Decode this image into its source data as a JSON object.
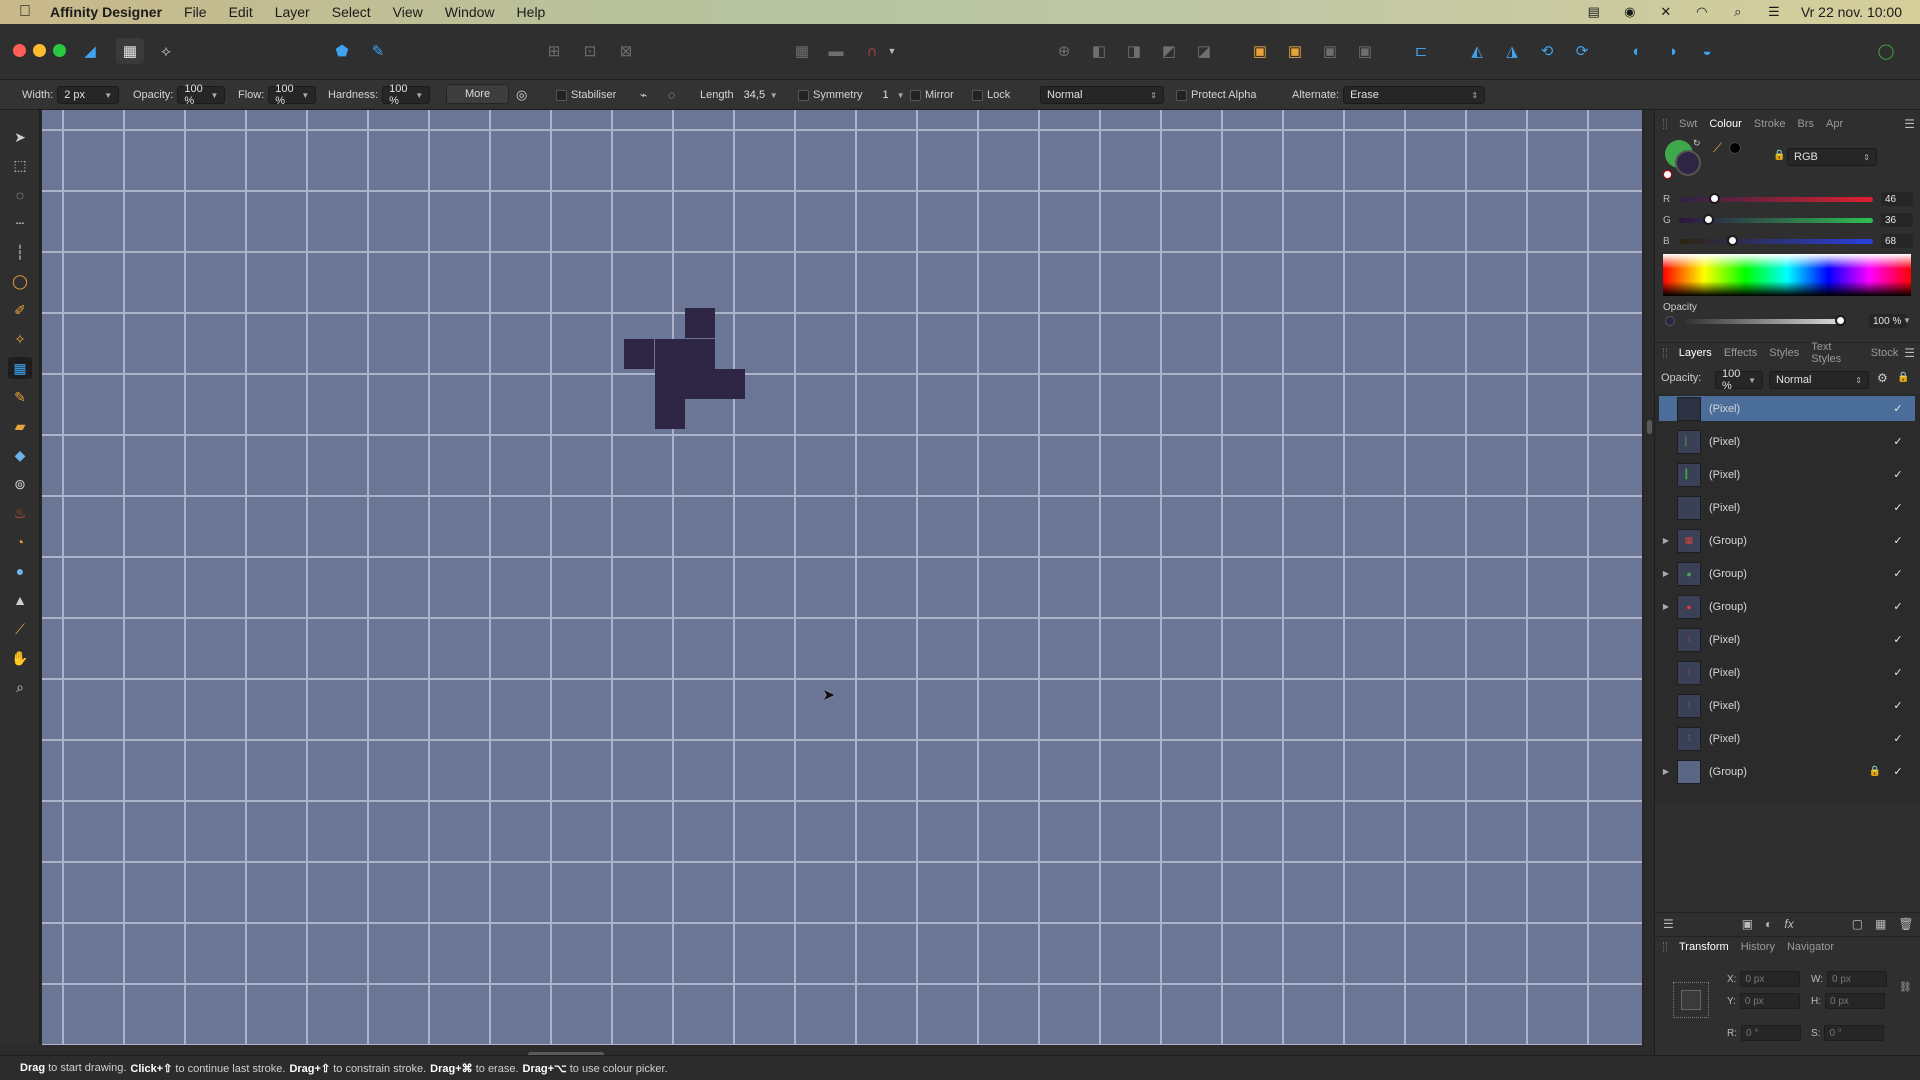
{
  "menubar": {
    "app_name": "Affinity Designer",
    "menus": [
      "File",
      "Edit",
      "Layer",
      "Select",
      "View",
      "Window",
      "Help"
    ],
    "datetime": "Vr 22 nov. 10:00"
  },
  "context_bar": {
    "width_label": "Width:",
    "width_value": "2 px",
    "opacity_label": "Opacity:",
    "opacity_value": "100 %",
    "flow_label": "Flow:",
    "flow_value": "100 %",
    "hardness_label": "Hardness:",
    "hardness_value": "100 %",
    "more_label": "More",
    "stabiliser_label": "Stabiliser",
    "length_label": "Length",
    "length_value": "34,5",
    "symmetry_label": "Symmetry",
    "symmetry_value": "1",
    "mirror_label": "Mirror",
    "lock_label": "Lock",
    "blend_value": "Normal",
    "protect_alpha_label": "Protect Alpha",
    "alternate_label": "Alternate:",
    "alternate_value": "Erase"
  },
  "colour_panel": {
    "tabs": [
      "Swt",
      "Colour",
      "Stroke",
      "Brs",
      "Apr"
    ],
    "active_tab": "Colour",
    "mode": "RGB",
    "r_label": "R",
    "r_value": "46",
    "g_label": "G",
    "g_value": "36",
    "b_label": "B",
    "b_value": "68",
    "opacity_label": "Opacity",
    "opacity_value": "100 %",
    "fill_color": "#2e2444",
    "stroke_color": "#3ea84a"
  },
  "layers_panel": {
    "tabs": [
      "Layers",
      "Effects",
      "Styles",
      "Text Styles",
      "Stock"
    ],
    "active_tab": "Layers",
    "opacity_label": "Opacity:",
    "opacity_value": "100 %",
    "blend_value": "Normal",
    "layers": [
      {
        "name": "(Pixel)",
        "selected": true
      },
      {
        "name": "(Pixel)"
      },
      {
        "name": "(Pixel)"
      },
      {
        "name": "(Pixel)"
      },
      {
        "name": "(Group)",
        "expandable": true
      },
      {
        "name": "(Group)",
        "expandable": true
      },
      {
        "name": "(Group)",
        "expandable": true
      },
      {
        "name": "(Pixel)"
      },
      {
        "name": "(Pixel)"
      },
      {
        "name": "(Pixel)"
      },
      {
        "name": "(Pixel)"
      },
      {
        "name": "(Group)",
        "expandable": true,
        "locked": true
      }
    ]
  },
  "transform_panel": {
    "tabs": [
      "Transform",
      "History",
      "Navigator"
    ],
    "active_tab": "Transform",
    "x_label": "X:",
    "x_value": "0 px",
    "y_label": "Y:",
    "y_value": "0 px",
    "w_label": "W:",
    "w_value": "0 px",
    "h_label": "H:",
    "h_value": "0 px",
    "r_label": "R:",
    "r_value": "0 °",
    "s_label": "S:",
    "s_value": "0 °"
  },
  "statusbar": {
    "parts": [
      {
        "bold": "Drag",
        "text": " to start drawing. "
      },
      {
        "bold": "Click+⇧",
        "text": " to continue last stroke. "
      },
      {
        "bold": "Drag+⇧",
        "text": " to constrain stroke. "
      },
      {
        "bold": "Drag+⌘",
        "text": " to erase. "
      },
      {
        "bold": "Drag+⌥",
        "text": " to use colour picker."
      }
    ]
  },
  "canvas": {
    "background_color": "#6b7596",
    "grid_color": "#aab3c7",
    "pixel_color": "#2e2444"
  }
}
